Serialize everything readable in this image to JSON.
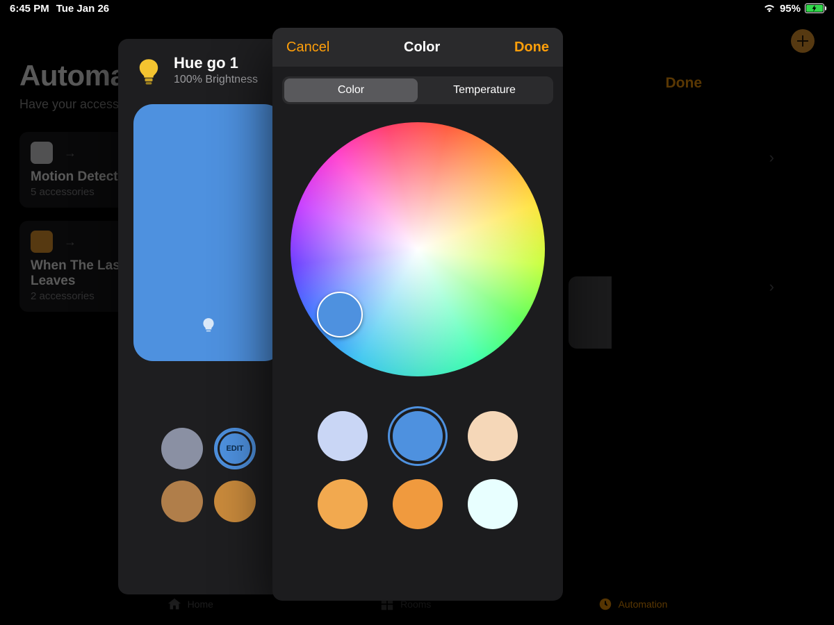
{
  "status_bar": {
    "time": "6:45 PM",
    "date": "Tue Jan 26",
    "battery_pct": "95%",
    "battery_fill_pct": 95
  },
  "background": {
    "page_title": "Automation",
    "page_subtitle": "Have your accessories react to changes at home.",
    "automations": [
      {
        "title": "Motion Detected",
        "subtitle": "5 accessories"
      },
      {
        "title": "When The Last Person Leaves",
        "subtitle": "2 accessories"
      }
    ],
    "right_done_label": "Done",
    "tabbar": [
      {
        "label": "Home",
        "active": false
      },
      {
        "label": "Rooms",
        "active": false
      },
      {
        "label": "Automation",
        "active": true
      }
    ]
  },
  "accessory_panel": {
    "name": "Hue go 1",
    "status": "100% Brightness",
    "swatches": [
      {
        "color": "#8a90a3"
      },
      {
        "color": "#4e91df",
        "is_edit_ring": true,
        "label": "EDIT"
      },
      {
        "color": "#b07e4a"
      },
      {
        "color": "#c98a3c"
      }
    ]
  },
  "color_panel": {
    "cancel_label": "Cancel",
    "title": "Color",
    "done_label": "Done",
    "segments": [
      {
        "label": "Color",
        "selected": true
      },
      {
        "label": "Temperature",
        "selected": false
      }
    ],
    "selected_color": "#4e91df",
    "swatches": [
      {
        "color": "#c9d6f5",
        "selected": false
      },
      {
        "color": "#4e91df",
        "selected": true
      },
      {
        "color": "#f5d7b8",
        "selected": false
      },
      {
        "color": "#f2a94f",
        "selected": false
      },
      {
        "color": "#f09a3e",
        "selected": false
      },
      {
        "color": "#e8ffff",
        "selected": false
      }
    ]
  },
  "colors": {
    "accent": "#ff9f0a",
    "tile_blue": "#4e91df"
  }
}
